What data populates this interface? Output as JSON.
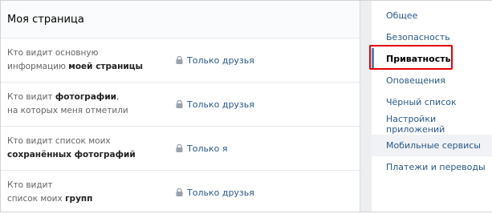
{
  "main": {
    "title": "Моя страница",
    "rows": [
      {
        "line1": "Кто видит основную",
        "line2_pre": "информацию ",
        "line2_bold": "моей страницы",
        "value": "Только друзья"
      },
      {
        "line1_pre": "Кто видит ",
        "line1_bold": "фотографии",
        "line1_post": ",",
        "line2": "на которых меня отметили",
        "value": "Только друзья"
      },
      {
        "line1": "Кто видит список моих",
        "line2_bold": "сохранённых фотографий",
        "value": "Только я"
      },
      {
        "line1": "Кто видит",
        "line2_pre": "список моих ",
        "line2_bold": "групп",
        "value": "Только друзья"
      }
    ]
  },
  "sidebar": {
    "items": [
      {
        "label": "Общее"
      },
      {
        "label": "Безопасность"
      },
      {
        "label": "Приватность"
      },
      {
        "label": "Оповещения"
      },
      {
        "label": "Чёрный список"
      },
      {
        "label": "Настройки приложений"
      },
      {
        "label": "Мобильные сервисы"
      },
      {
        "label": "Платежи и переводы"
      }
    ]
  },
  "icons": {
    "value_icon": "lock-icon"
  },
  "colors": {
    "link": "#2a5885",
    "highlight": "#e60000",
    "active_marker": "#5181b8"
  }
}
